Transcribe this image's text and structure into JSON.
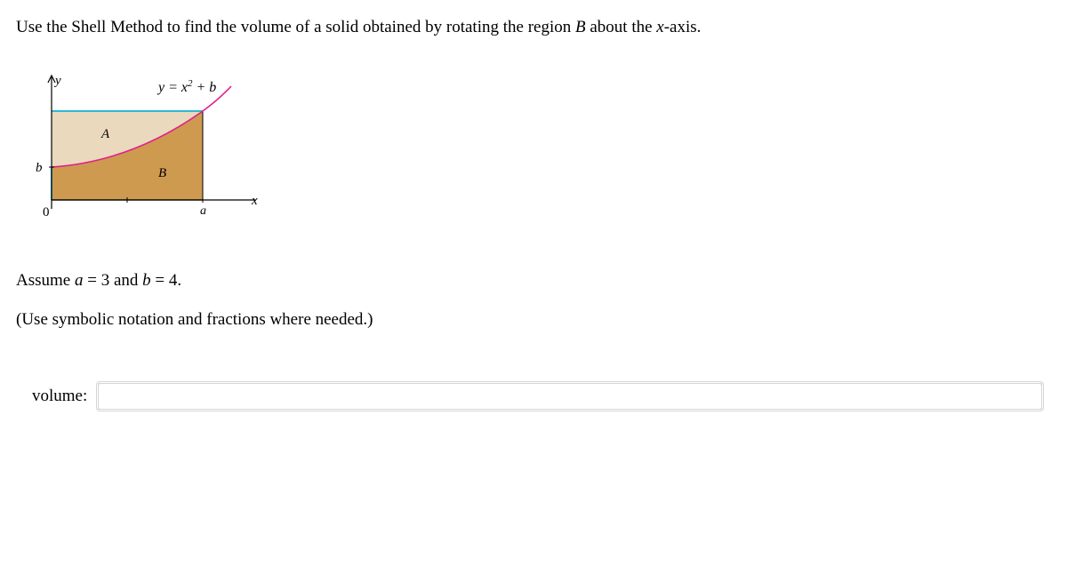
{
  "question": {
    "prefix": "Use the Shell Method to find the volume of a solid obtained by rotating the region ",
    "region_var": "B",
    "middle": " about the ",
    "axis_var": "x",
    "suffix": "-axis."
  },
  "figure": {
    "y_label": "y",
    "x_label": "x",
    "b_label": "b",
    "a_tick": "a",
    "zero_label": "0",
    "region_a": "A",
    "region_b": "B",
    "curve_label_parts": {
      "p1": "y = x",
      "sup": "2",
      "p2": " + b"
    }
  },
  "assumption": {
    "prefix": "Assume ",
    "a_var": "a",
    "eq1": " = 3 and ",
    "b_var": "b",
    "eq2": " = 4."
  },
  "instruction": "(Use symbolic notation and fractions where needed.)",
  "answer": {
    "label": "volume:",
    "value": "",
    "placeholder": ""
  },
  "chart_data": {
    "type": "area",
    "title": "",
    "curve": "y = x^2 + b",
    "x_range": [
      0,
      "a"
    ],
    "regions": [
      {
        "name": "A",
        "desc": "above curve, inside rectangle"
      },
      {
        "name": "B",
        "desc": "below curve, inside rectangle"
      }
    ],
    "rectangle": {
      "x": [
        0,
        "a"
      ],
      "y": [
        0,
        "a^2+b"
      ]
    },
    "intercept_y": "b",
    "parameters": {
      "a": 3,
      "b": 4
    }
  }
}
